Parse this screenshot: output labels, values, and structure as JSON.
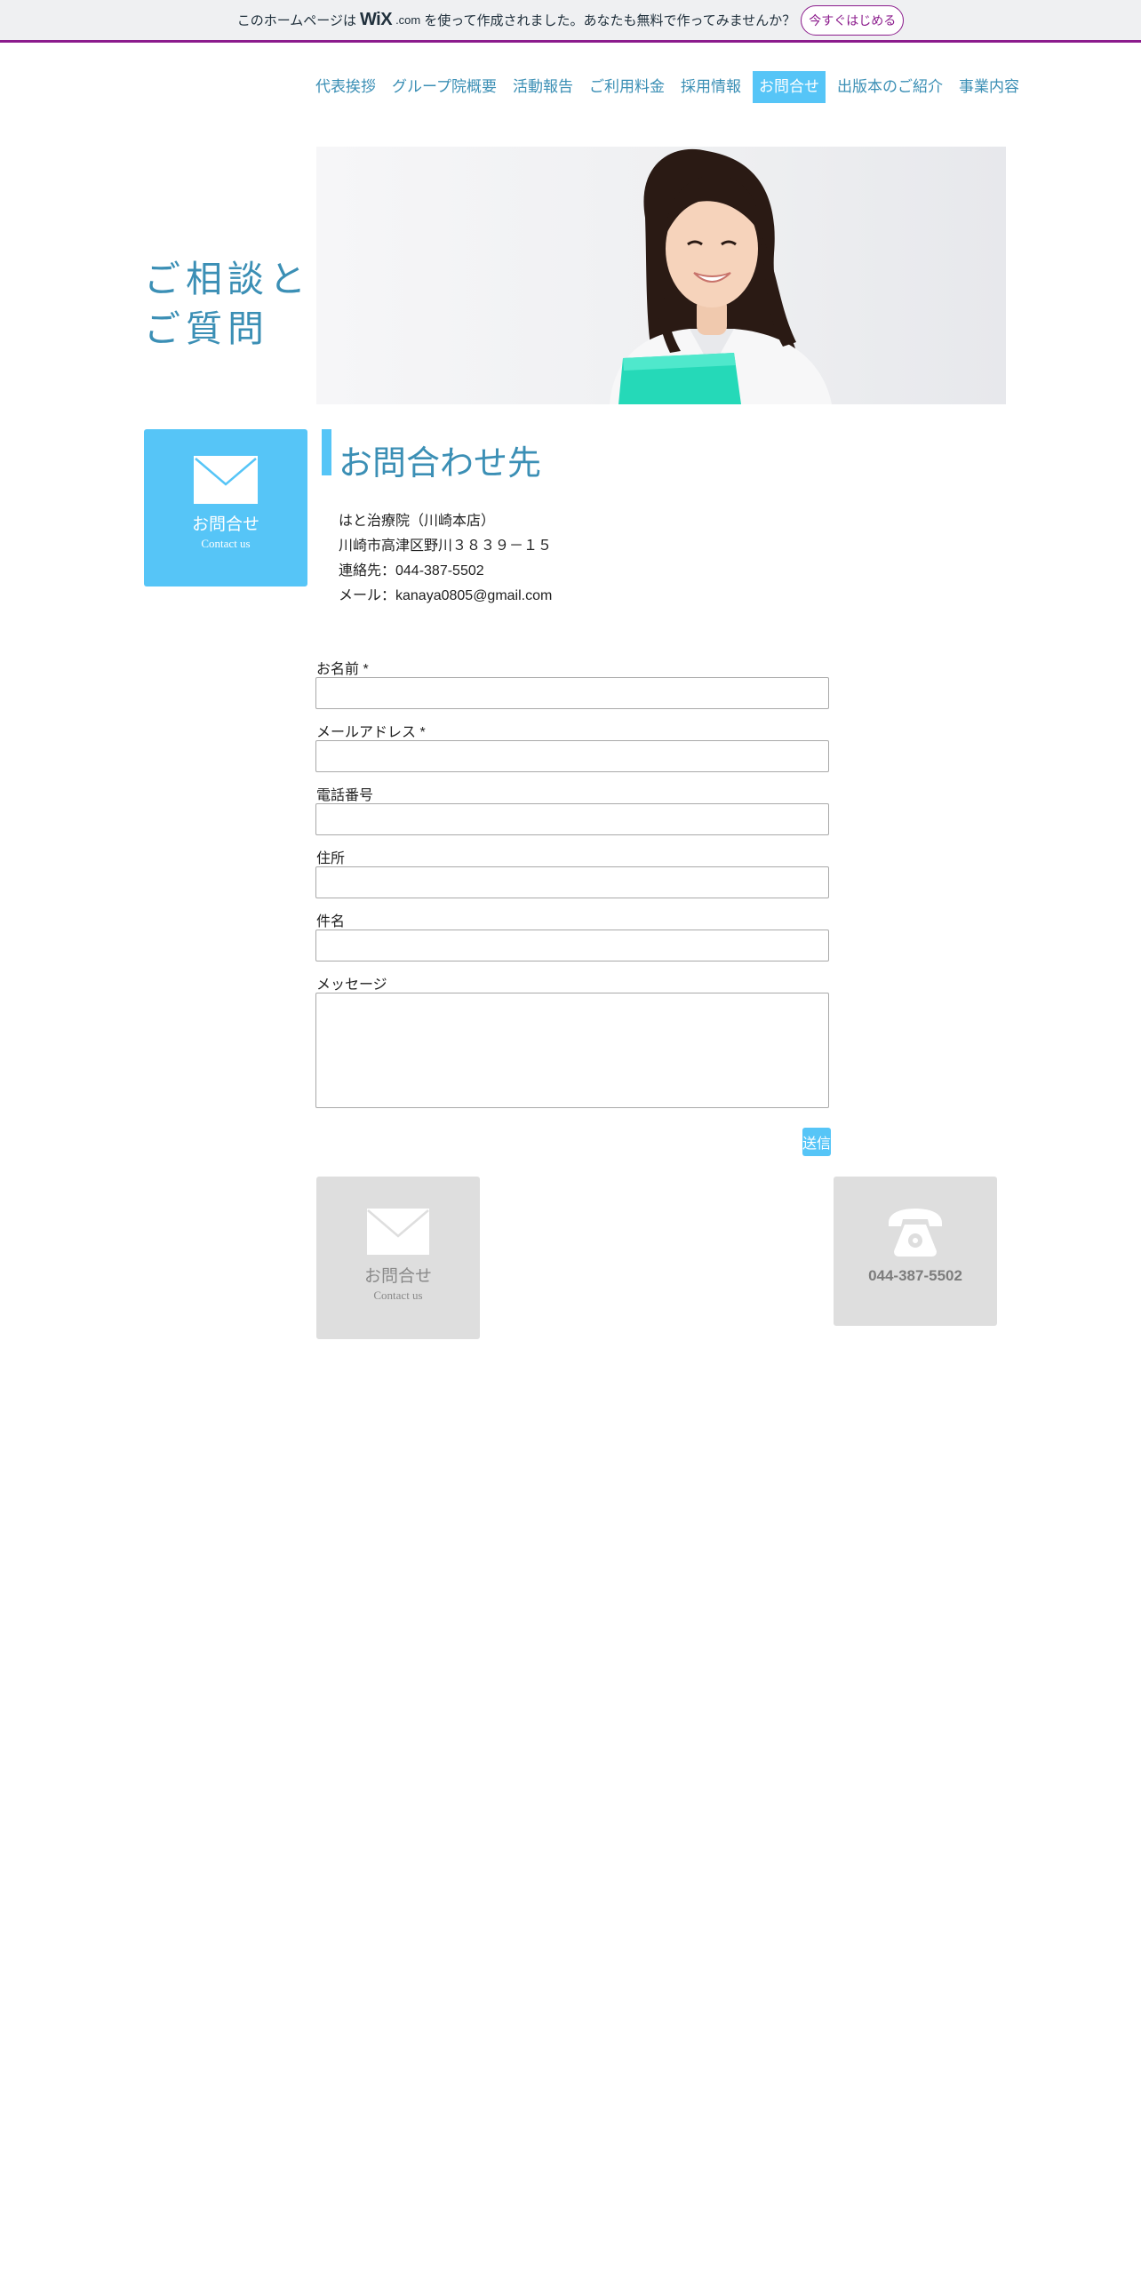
{
  "banner": {
    "text_before": "このホームページは",
    "logo": "WiX",
    "logo_suffix": ".com",
    "text_after": "を使って作成されました。あなたも無料で作ってみませんか？",
    "cta": "今すぐはじめる"
  },
  "nav": {
    "items": [
      {
        "label": "代表挨拶"
      },
      {
        "label": "グループ院概要"
      },
      {
        "label": "活動報告"
      },
      {
        "label": "ご利用料金"
      },
      {
        "label": "採用情報"
      },
      {
        "label": "お問合せ"
      },
      {
        "label": "出版本のご紹介"
      },
      {
        "label": "事業内容"
      }
    ],
    "active_index": 5
  },
  "hero": {
    "title_line1": "ご相談と",
    "title_line2": "ご質問"
  },
  "contact_tile": {
    "label": "お問合せ",
    "sub": "Contact us",
    "icon": "envelope-icon"
  },
  "section": {
    "heading": "お問合わせ先",
    "address_lines": [
      "はと治療院（川崎本店）",
      "川崎市高津区野川３８３９－１５",
      "連絡先：044-387-5502",
      "メール：kanaya0805@gmail.com"
    ]
  },
  "form": {
    "name_label": "お名前 *",
    "email_label": "メールアドレス *",
    "phone_label": "電話番号",
    "address_label": "住所",
    "subject_label": "件名",
    "message_label": "メッセージ",
    "submit_label": "送信"
  },
  "footer_tiles": {
    "contact_label": "お問合せ",
    "contact_sub": "Contact us",
    "phone_number": "044-387-5502",
    "phone_icon": "telephone-icon"
  },
  "colors": {
    "accent": "#56c5f7",
    "link": "#3b8fb5",
    "banner_border": "#8b1b8c",
    "tile_gray": "#dedede"
  }
}
